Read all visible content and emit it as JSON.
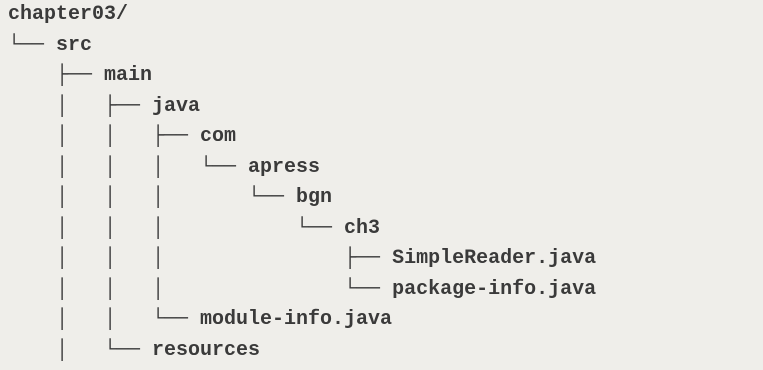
{
  "tree": {
    "lines": [
      "chapter03/",
      "└── src",
      "    ├── main",
      "    │   ├── java",
      "    │   │   ├── com",
      "    │   │   │   └── apress",
      "    │   │   │       └── bgn",
      "    │   │   │           └── ch3",
      "    │   │   │               ├── SimpleReader.java",
      "    │   │   │               └── package-info.java",
      "    │   │   └── module-info.java",
      "    │   └── resources"
    ]
  }
}
